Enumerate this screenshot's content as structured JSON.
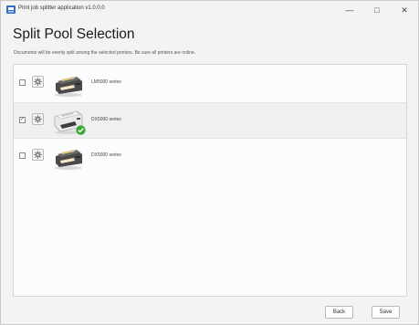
{
  "window": {
    "title": "Print job splitter application v1.0.0.0",
    "minimize_symbol": "—",
    "maximize_symbol": "□",
    "close_symbol": "✕"
  },
  "page": {
    "title": "Split Pool Selection",
    "subtitle": "Documents will be evenly split among the selected printers.  Be sure all printers are online."
  },
  "printers": [
    {
      "name": "LM5000 series",
      "checked": false,
      "check_mark": "",
      "status": "none"
    },
    {
      "name": "DX5000 series",
      "checked": true,
      "check_mark": "✓",
      "status": "online-check"
    },
    {
      "name": "DX5000 series",
      "checked": false,
      "check_mark": "",
      "status": "none"
    }
  ],
  "footer": {
    "back_label": "Back",
    "save_label": "Save"
  },
  "colors": {
    "accent_green": "#3aa935",
    "window_bg": "#f3f3f3",
    "list_bg": "#fcfcfc",
    "selected_row_bg": "#f0f0f0"
  }
}
